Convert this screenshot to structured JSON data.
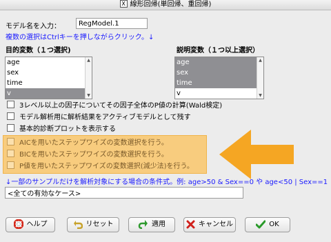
{
  "window": {
    "title": "線形回帰(単回帰、重回帰)"
  },
  "model_name": {
    "label": "モデル名を入力：",
    "value": "RegModel.1"
  },
  "hint": "複数の選択はCtrlキーを押しながらクリック。↓",
  "response": {
    "label": "目的変数（１つ選択)",
    "items": [
      {
        "text": "age",
        "selected": false
      },
      {
        "text": "sex",
        "selected": false
      },
      {
        "text": "time",
        "selected": false
      },
      {
        "text": "v",
        "selected": true
      }
    ]
  },
  "explanatory": {
    "label": "説明変数（１つ以上選択）",
    "items": [
      {
        "text": "age",
        "selected": true
      },
      {
        "text": "sex",
        "selected": true
      },
      {
        "text": "time",
        "selected": true
      },
      {
        "text": "v",
        "selected": false
      }
    ]
  },
  "options": [
    {
      "label": "3レベル以上の因子についてその因子全体のP値の計算(Wald検定)"
    },
    {
      "label": "モデル解析用に解析結果をアクティブモデルとして残す"
    },
    {
      "label": "基本的診断プロットを表示する"
    }
  ],
  "stepwise_options": [
    {
      "label": "AICを用いたステップワイズの変数選択を行う。"
    },
    {
      "label": "BICを用いたステップワイズの変数選択を行う。"
    },
    {
      "label": "P値を用いたステップワイズの変数選択(減少法)を行う。"
    }
  ],
  "subset": {
    "label": "↓一部のサンプルだけを解析対象にする場合の条件式。例: age>50 & Sex==0 や age<50 | Sex==1",
    "value": "<全ての有効なケース>"
  },
  "buttons": {
    "help": "ヘルプ",
    "reset": "リセット",
    "apply": "適用",
    "cancel": "キャンセル",
    "ok": "OK"
  },
  "colors": {
    "highlight": "#f8cc7e",
    "arrow": "#f5a623",
    "hint_text": "#1a1aff",
    "selection": "#8f8f93"
  }
}
